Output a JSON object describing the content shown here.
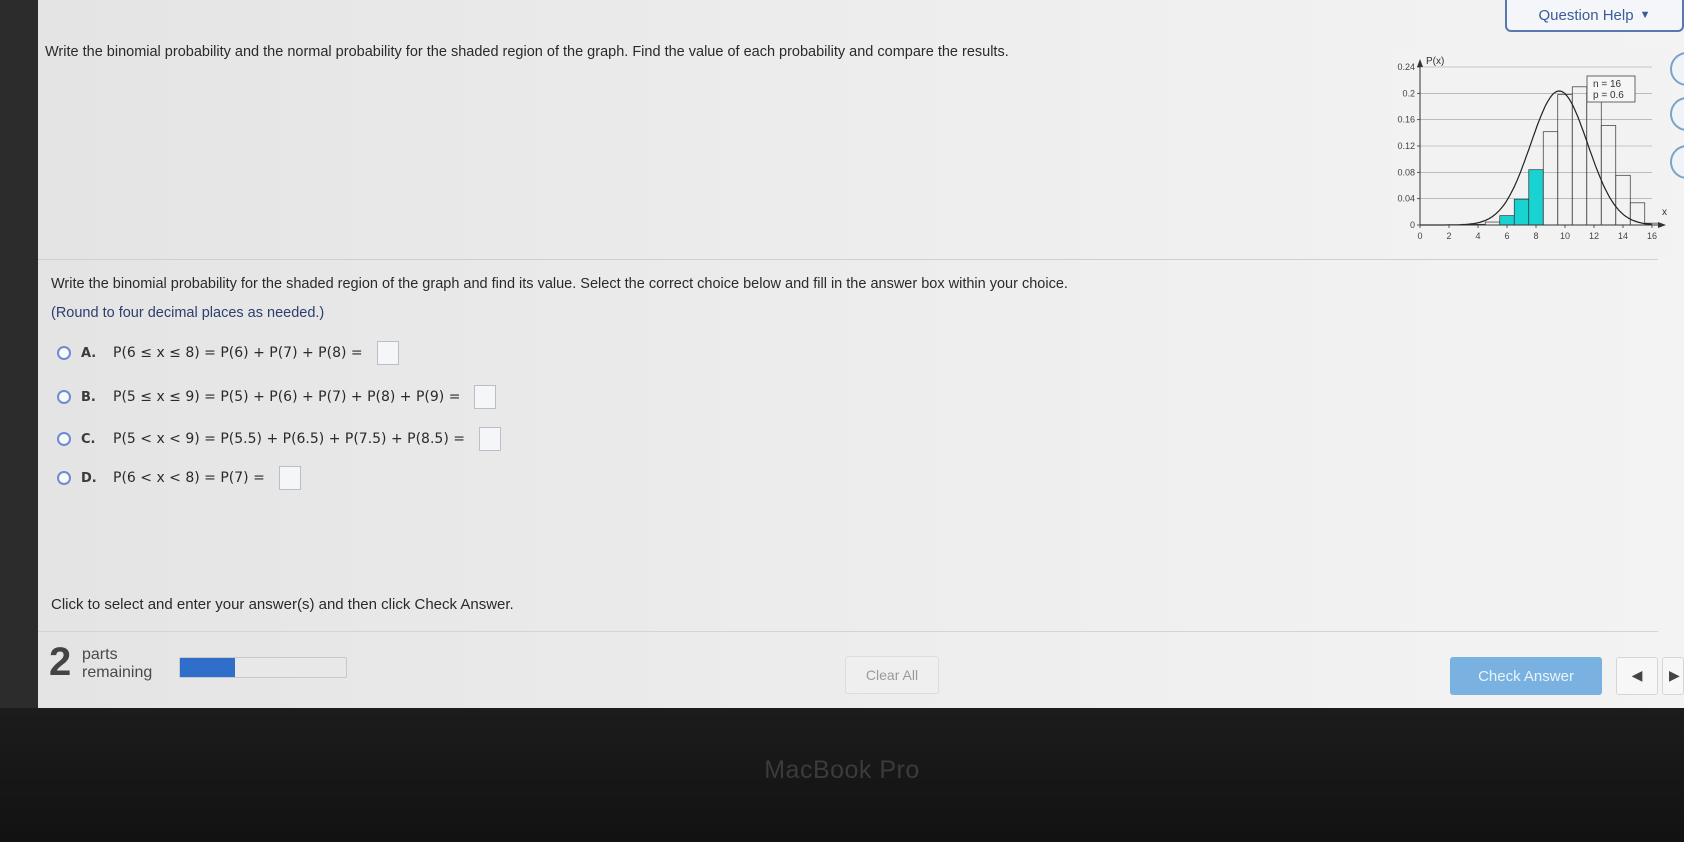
{
  "header": {
    "question_help_label": "Question Help",
    "question_help_arrow": "▼"
  },
  "instruction": "Write the binomial probability and the normal probability for the shaded region of the graph. Find the value of each probability and compare the results.",
  "graph": {
    "y_axis_label": "P(x)",
    "legend_n": "n = 16",
    "legend_p": "p = 0.6",
    "y_ticks": [
      "0.24",
      "0.2",
      "0.16",
      "0.12",
      "0.08",
      "0.04",
      "0"
    ],
    "x_ticks": [
      "0",
      "2",
      "4",
      "6",
      "8",
      "10",
      "12",
      "14",
      "16"
    ],
    "x_axis_label": "x",
    "shade_color": "#19d3d3"
  },
  "chart_data": {
    "type": "bar",
    "title": "",
    "ylabel": "P(x)",
    "xlabel": "x",
    "x": [
      0,
      1,
      2,
      3,
      4,
      5,
      6,
      7,
      8,
      9,
      10,
      11,
      12,
      13,
      14,
      15,
      16
    ],
    "values": [
      0.0,
      0.0,
      0.0,
      0.0002,
      0.0011,
      0.0045,
      0.0142,
      0.0392,
      0.084,
      0.1417,
      0.1983,
      0.2099,
      0.2013,
      0.1511,
      0.0755,
      0.0337,
      0.0028
    ],
    "shaded": [
      6,
      7,
      8
    ],
    "ylim": [
      0,
      0.24
    ],
    "xlim": [
      0,
      16
    ],
    "annotations": [
      "n = 16",
      "p = 0.6"
    ]
  },
  "question": {
    "prompt": "Write the binomial probability for the shaded region of the graph and find its value. Select the correct choice below and fill in the answer box within your choice.",
    "round_note": "(Round to four decimal places as needed.)",
    "choices": [
      {
        "letter": "A.",
        "text": "P(6 ≤ x ≤ 8) = P(6) + P(7) + P(8) ="
      },
      {
        "letter": "B.",
        "text": "P(5 ≤ x ≤ 9) = P(5) + P(6) + P(7) + P(8) + P(9) ="
      },
      {
        "letter": "C.",
        "text": "P(5 < x < 9) = P(5.5) + P(6.5) + P(7.5) + P(8.5) ="
      },
      {
        "letter": "D.",
        "text": "P(6 < x < 8) = P(7) ="
      }
    ]
  },
  "footer": {
    "cta": "Click to select and enter your answer(s) and then click Check Answer.",
    "parts_count": "2",
    "parts_label_line1": "parts",
    "parts_label_line2": "remaining",
    "progress_fraction": 0.33,
    "clear_all_label": "Clear All",
    "check_answer_label": "Check Answer",
    "prev_arrow": "◀",
    "next_arrow": "▶",
    "accent_color": "#2f6fc9",
    "button_color": "#79b2e0"
  },
  "device": {
    "brand": "MacBook Pro"
  }
}
